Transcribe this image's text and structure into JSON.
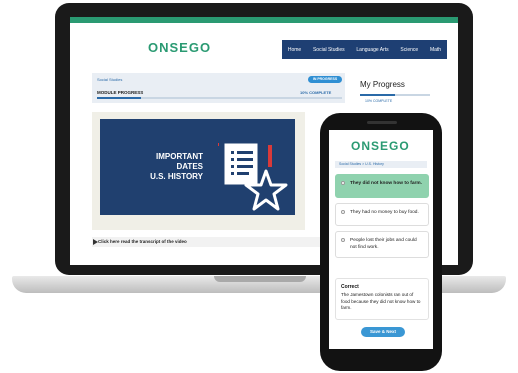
{
  "brand": {
    "name": "ONSEGO",
    "accent": "#2a9a72",
    "nav_bg": "#1e3f73"
  },
  "nav": {
    "items": [
      "Home",
      "Social Studies",
      "Language Arts",
      "Science",
      "Math"
    ]
  },
  "course": {
    "breadcrumb": "Social Studies",
    "status_badge": "IN PROGRESS",
    "module_label": "MODULE PROGRESS",
    "module_percent_text": "10% COMPLETE",
    "module_progress": 0.18
  },
  "sidebar": {
    "title": "My Progress",
    "percent_text": "10% COMPLETE",
    "progress": 0.5
  },
  "video": {
    "title_line1": "IMPORTANT DATES",
    "title_line2": "U.S. HISTORY",
    "transcript_label": "Click here read the transcript of the video"
  },
  "phone": {
    "breadcrumb": "Social Studies > U.S. History",
    "options": [
      "They did not know how to farm.",
      "They had no money to buy food.",
      "People lost their jobs and could not find work."
    ],
    "selected_option": 0,
    "feedback_title": "Correct",
    "feedback_text": "The Jamestown colonists ran out of food because they did not know how to farm.",
    "save_label": "Save & Next"
  }
}
